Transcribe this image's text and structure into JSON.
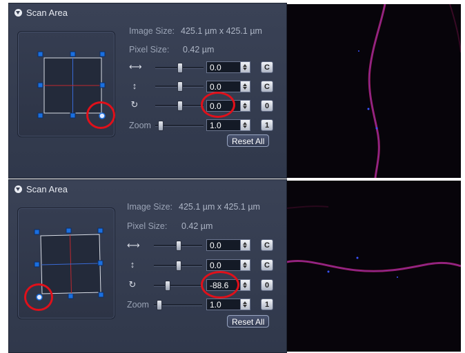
{
  "top": {
    "section_title": "Scan Area",
    "image_size_label": "Image Size:",
    "image_size_value": "425.1 µm x 425.1 µm",
    "pixel_size_label": "Pixel Size:",
    "pixel_size_value": "0.42 µm",
    "offset_x_value": "0.0",
    "offset_y_value": "0.0",
    "rotation_value": "0.0",
    "zoom_label": "Zoom",
    "zoom_value": "1.0",
    "offset_x_btn": "C",
    "offset_y_btn": "C",
    "rotation_btn": "0",
    "zoom_btn": "1",
    "reset_label": "Reset All"
  },
  "bottom": {
    "section_title": "Scan Area",
    "image_size_label": "Image Size:",
    "image_size_value": "425.1 µm x 425.1 µm",
    "pixel_size_label": "Pixel Size:",
    "pixel_size_value": "0.42 µm",
    "offset_x_value": "0.0",
    "offset_y_value": "0.0",
    "rotation_value": "-88.6",
    "zoom_label": "Zoom",
    "zoom_value": "1.0",
    "offset_x_btn": "C",
    "offset_y_btn": "C",
    "rotation_btn": "0",
    "zoom_btn": "1",
    "reset_label": "Reset All"
  },
  "icons": {
    "offset_x": "horizontal-arrow-icon",
    "offset_y": "vertical-arrow-icon",
    "rotation": "rotation-icon"
  },
  "colors": {
    "panel_bg": "#353d51",
    "highlight_circle": "#e0101a",
    "handle": "#1a6fe0",
    "specimen_fiber": "#c8207a"
  }
}
